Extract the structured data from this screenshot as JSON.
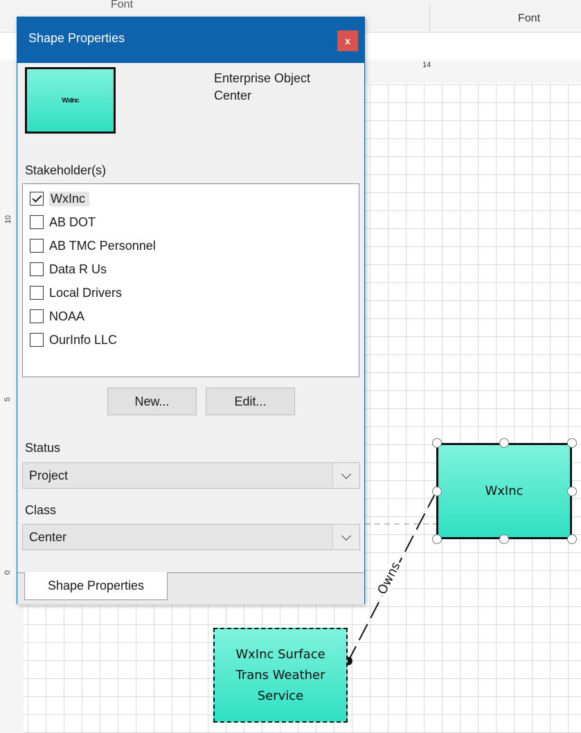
{
  "ribbon": {
    "left_group_label": "Font",
    "right_group_label": "Font"
  },
  "rulers": {
    "top_number": "14",
    "left_numbers": [
      "10",
      "5",
      "0"
    ]
  },
  "panel": {
    "title": "Shape Properties",
    "close_label": "x",
    "preview_text": "WxInc",
    "info_line_1": "Enterprise Object",
    "info_line_2": "Center",
    "stakeholders_label": "Stakeholder(s)",
    "stakeholders": [
      {
        "label": "WxInc",
        "checked": true
      },
      {
        "label": "AB DOT",
        "checked": false
      },
      {
        "label": "AB TMC Personnel",
        "checked": false
      },
      {
        "label": "Data R Us",
        "checked": false
      },
      {
        "label": "Local Drivers",
        "checked": false
      },
      {
        "label": "NOAA",
        "checked": false
      },
      {
        "label": "OurInfo LLC",
        "checked": false
      }
    ],
    "new_button": "New...",
    "edit_button": "Edit...",
    "status_label": "Status",
    "status_value": "Project",
    "class_label": "Class",
    "class_value": "Center",
    "tab_label": "Shape Properties"
  },
  "canvas": {
    "main_shape_text": "WxInc",
    "service_shape_text": "WxInc Surface\nTrans Weather\nService",
    "connector_label": "Owns",
    "shape_fill_top": "#7ff3dd",
    "shape_fill_bottom": "#2fe0c2"
  },
  "colors": {
    "titlebar": "#0f62ac",
    "close_button": "#d9534f"
  }
}
